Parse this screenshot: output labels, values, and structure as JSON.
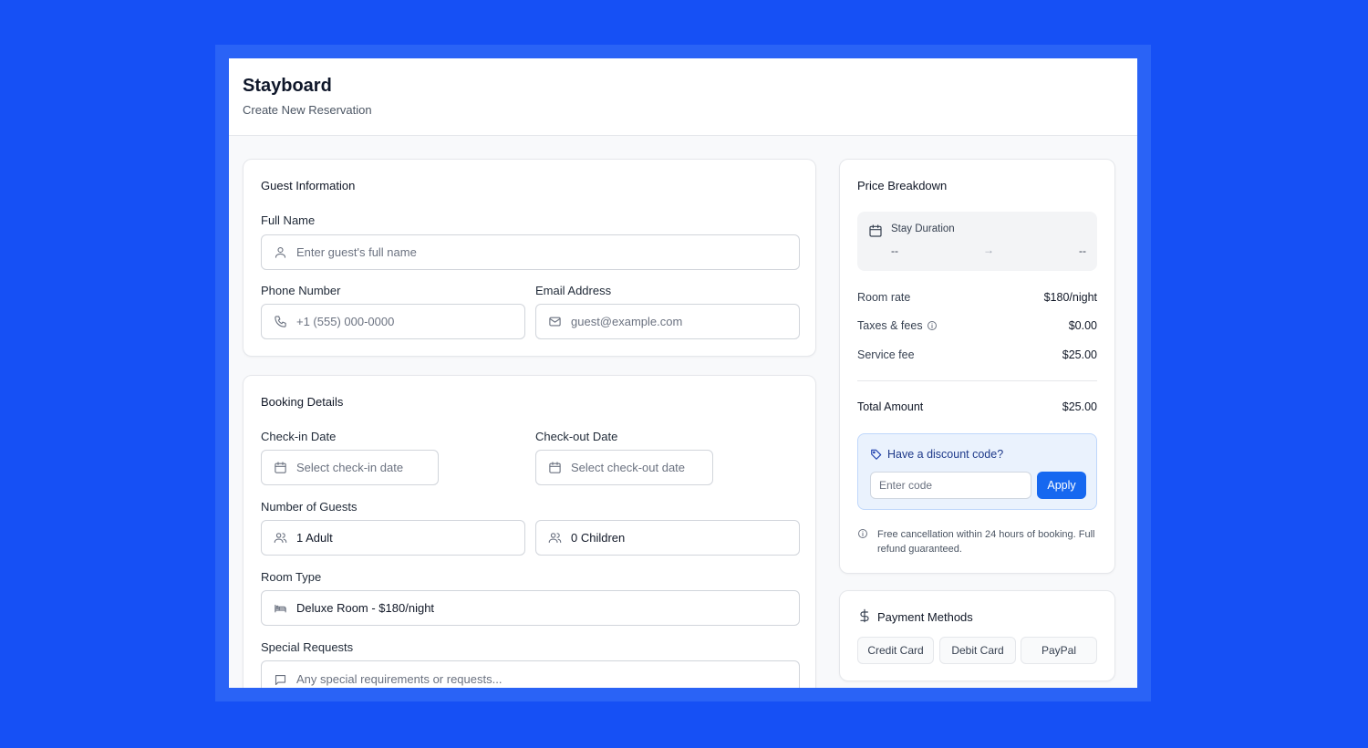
{
  "app": {
    "title": "Stayboard",
    "subtitle": "Create New Reservation"
  },
  "guest": {
    "title": "Guest Information",
    "full_name": {
      "label": "Full Name",
      "placeholder": "Enter guest's full name"
    },
    "phone": {
      "label": "Phone Number",
      "placeholder": "+1 (555) 000-0000"
    },
    "email": {
      "label": "Email Address",
      "placeholder": "guest@example.com"
    }
  },
  "booking": {
    "title": "Booking Details",
    "checkin": {
      "label": "Check-in Date",
      "placeholder": "Select check-in date"
    },
    "checkout": {
      "label": "Check-out Date",
      "placeholder": "Select check-out date"
    },
    "guests": {
      "label": "Number of Guests",
      "adults": "1 Adult",
      "children": "0 Children"
    },
    "room": {
      "label": "Room Type",
      "value": "Deluxe Room - $180/night"
    },
    "requests": {
      "label": "Special Requests",
      "placeholder": "Any special requirements or requests..."
    }
  },
  "price": {
    "title": "Price Breakdown",
    "stay": {
      "label": "Stay Duration",
      "from": "--",
      "arrow": "→",
      "to": "--"
    },
    "rows": [
      {
        "label": "Room rate",
        "amount": "$180/night"
      },
      {
        "label": "Taxes & fees",
        "amount": "$0.00"
      },
      {
        "label": "Service fee",
        "amount": "$25.00"
      }
    ],
    "total": {
      "label": "Total Amount",
      "amount": "$25.00"
    },
    "discount": {
      "title": "Have a discount code?",
      "placeholder": "Enter code",
      "button": "Apply"
    },
    "note": "Free cancellation within 24 hours of booking. Full refund guaranteed."
  },
  "payment": {
    "title": "Payment Methods",
    "methods": [
      "Credit Card",
      "Debit Card",
      "PayPal"
    ]
  },
  "colors": {
    "background": "#1650f5",
    "accent": "#1668f0",
    "discount_bg": "#eaf2fd"
  }
}
